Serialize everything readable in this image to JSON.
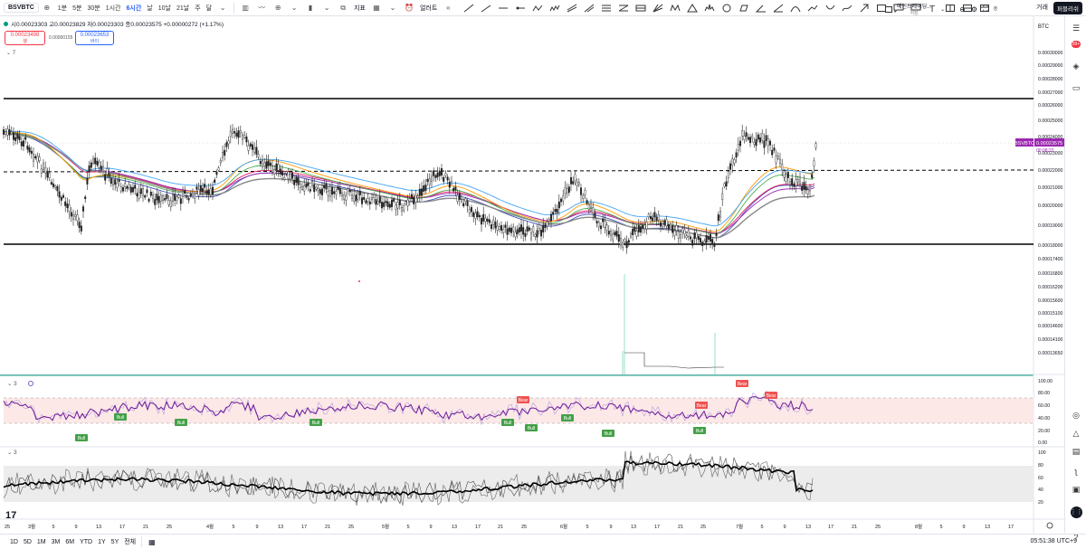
{
  "header": {
    "symbol": "BSVBTC",
    "timeframes": [
      "1분",
      "5분",
      "30분",
      "1시간",
      "6시간",
      "날",
      "10날",
      "21날",
      "주",
      "달"
    ],
    "active_timeframe": "6시간",
    "indicators_label": "지표",
    "alert_label": "얼러트",
    "layout_name": "메인트레이딩...",
    "layout_sub": "저장",
    "trade_label": "거래",
    "publish_label": "퍼블리쉬"
  },
  "legend": {
    "text": "시0.00023303 고0.00023829 저0.00023303 종0.00023575 +0.00000272 (+1.17%)"
  },
  "order": {
    "sell_price": "0.00023498",
    "sell_label": "셀",
    "spread": "0.00000155",
    "buy_price": "0.00023653",
    "buy_label": "바이"
  },
  "panes": {
    "main_collapse": "7",
    "rsi_collapse": "3",
    "stoch_collapse": "3"
  },
  "price_axis": {
    "currency": "BTC",
    "labels": [
      "0.00030000",
      "0.00029000",
      "0.00028000",
      "0.00027000",
      "0.00026000",
      "0.00025000",
      "0.00024000",
      "0.00023000",
      "0.00022000",
      "0.00021000",
      "0.00020000",
      "0.00019000",
      "0.00018000",
      "0.00017400",
      "0.00016800",
      "0.00016200",
      "0.00015600",
      "0.00015100",
      "0.00014600",
      "0.00014100",
      "0.00013650"
    ],
    "current_tag": "BSVBTC",
    "current_price": "0.00023575",
    "countdown": "00:08:22"
  },
  "rsi_axis": [
    "100.00",
    "80.00",
    "60.00",
    "40.00",
    "20.00",
    "0.00"
  ],
  "stoch_axis": [
    "100",
    "80",
    "60",
    "40",
    "20"
  ],
  "rsi_signals": [
    {
      "text": "Bull",
      "color": "#43a047"
    },
    {
      "text": "Bull",
      "color": "#43a047"
    },
    {
      "text": "Bull",
      "color": "#43a047"
    },
    {
      "text": "Bull",
      "color": "#43a047"
    },
    {
      "text": "Bull",
      "color": "#43a047"
    },
    {
      "text": "Bull",
      "color": "#43a047"
    },
    {
      "text": "Bull",
      "color": "#43a047"
    },
    {
      "text": "Bull",
      "color": "#43a047"
    },
    {
      "text": "Bull",
      "color": "#43a047"
    },
    {
      "text": "Bear",
      "color": "#ef5350"
    },
    {
      "text": "Bear",
      "color": "#ef5350"
    },
    {
      "text": "Bear",
      "color": "#ef5350"
    },
    {
      "text": "Bear",
      "color": "#ef5350"
    }
  ],
  "time_axis": [
    "25",
    "3월",
    "5",
    "9",
    "13",
    "17",
    "21",
    "25",
    "4월",
    "5",
    "9",
    "13",
    "17",
    "21",
    "25",
    "5월",
    "5",
    "9",
    "13",
    "17",
    "21",
    "25",
    "6월",
    "5",
    "9",
    "13",
    "17",
    "21",
    "25",
    "7월",
    "5",
    "9",
    "13",
    "17",
    "21",
    "25",
    "8월",
    "5",
    "9",
    "13",
    "17"
  ],
  "bottom": {
    "ranges": [
      "1D",
      "5D",
      "1M",
      "3M",
      "6M",
      "YTD",
      "1Y",
      "5Y",
      "전체"
    ],
    "clock": "05:51:38 UTC+9"
  },
  "colors": {
    "up": "#089981",
    "down": "#f23645",
    "accent": "#2962ff",
    "price_tag": "#9c27b0"
  }
}
